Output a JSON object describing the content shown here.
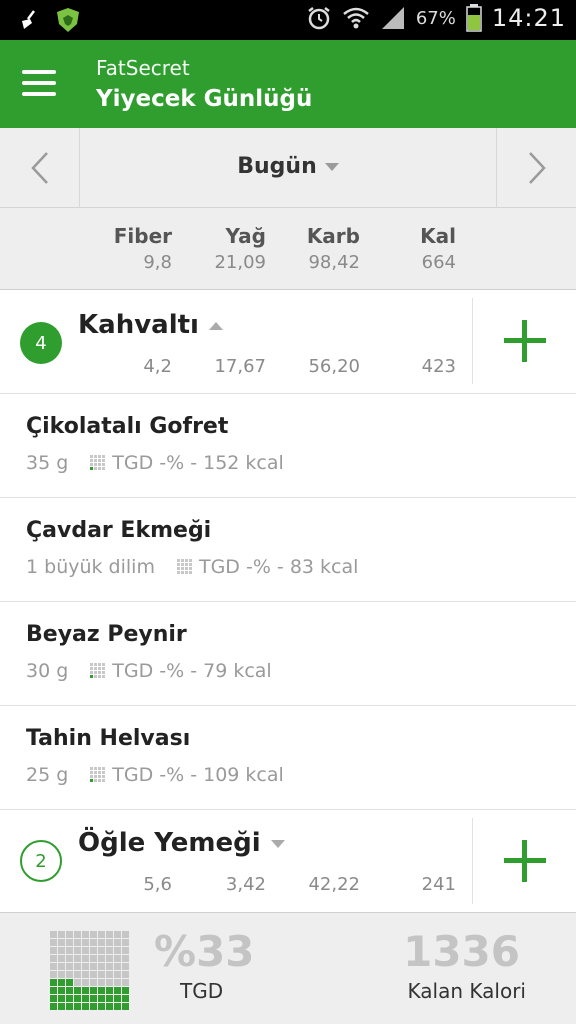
{
  "status_bar": {
    "battery_pct": "67%",
    "time": "14:21",
    "icons": [
      "broom-icon",
      "shield-icon",
      "alarm-icon",
      "wifi-icon",
      "signal-icon",
      "battery-icon"
    ]
  },
  "app_bar": {
    "app_name": "FatSecret",
    "title": "Yiyecek Günlüğü"
  },
  "date_nav": {
    "label": "Bugün"
  },
  "summary": {
    "headers": [
      "Fiber",
      "Yağ",
      "Karb",
      "Kal"
    ],
    "values": [
      "9,8",
      "21,09",
      "98,42",
      "664"
    ]
  },
  "meals": [
    {
      "number": "4",
      "name": "Kahvaltı",
      "values": [
        "4,2",
        "17,67",
        "56,20",
        "423"
      ],
      "expanded": true,
      "items": [
        {
          "name": "Çikolatalı Gofret",
          "qty": "35 g",
          "info": "TGD -% - 152 kcal"
        },
        {
          "name": "Çavdar Ekmeği",
          "qty": "1 büyük dilim",
          "info": "TGD -% - 83 kcal"
        },
        {
          "name": "Beyaz Peynir",
          "qty": "30 g",
          "info": "TGD -% - 79 kcal"
        },
        {
          "name": "Tahin Helvası",
          "qty": "25 g",
          "info": "TGD -% - 109 kcal"
        }
      ]
    },
    {
      "number": "2",
      "name": "Öğle Yemeği",
      "values": [
        "5,6",
        "3,42",
        "42,22",
        "241"
      ],
      "expanded": false,
      "items": []
    }
  ],
  "footer": {
    "percent": "%33",
    "percent_label": "TGD",
    "remaining": "1336",
    "remaining_label": "Kalan Kalori",
    "rdi_fraction": 0.33
  },
  "colors": {
    "brand_green": "#2f9e2f",
    "status_bar": "#000000",
    "panel_gray": "#eeeeee"
  }
}
